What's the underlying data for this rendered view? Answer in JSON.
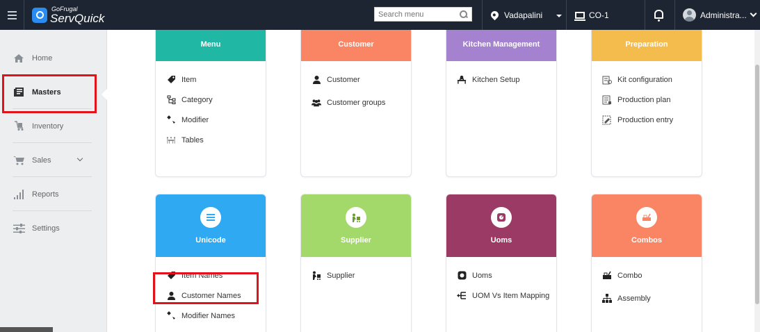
{
  "topbar": {
    "brand_small": "GoFrugal",
    "brand_big": "ServQuick",
    "search_placeholder": "Search menu",
    "location": "Vadapalini",
    "company": "CO-1",
    "user": "Administra..."
  },
  "sidebar": {
    "items": [
      {
        "label": "Home",
        "icon": "home-icon"
      },
      {
        "label": "Masters",
        "icon": "masters-icon"
      },
      {
        "label": "Inventory",
        "icon": "inventory-icon"
      },
      {
        "label": "Sales",
        "icon": "cart-icon"
      },
      {
        "label": "Reports",
        "icon": "bar-chart-icon"
      },
      {
        "label": "Settings",
        "icon": "sliders-icon"
      }
    ]
  },
  "cards": [
    {
      "title": "Menu",
      "color": "#20b7a4",
      "items": [
        "Item",
        "Category",
        "Modifier",
        "Tables"
      ]
    },
    {
      "title": "Customer",
      "color": "#f98564",
      "items": [
        "Customer",
        "Customer groups"
      ]
    },
    {
      "title": "Kitchen Management",
      "color": "#a482cf",
      "items": [
        "Kitchen Setup"
      ]
    },
    {
      "title": "Preparation",
      "color": "#f4bc4c",
      "items": [
        "Kit configuration",
        "Production plan",
        "Production entry"
      ]
    },
    {
      "title": "Unicode",
      "color": "#2faaf2",
      "items": [
        "Item Names",
        "Customer Names",
        "Modifier Names"
      ]
    },
    {
      "title": "Supplier",
      "color": "#a3d86a",
      "items": [
        "Supplier"
      ]
    },
    {
      "title": "Uoms",
      "color": "#9b3b65",
      "items": [
        "Uoms",
        "UOM Vs Item Mapping"
      ]
    },
    {
      "title": "Combos",
      "color": "#f98564",
      "items": [
        "Combo",
        "Assembly"
      ]
    }
  ],
  "colors": {
    "topbar": "#1c2531",
    "highlight": "#e0121a"
  }
}
